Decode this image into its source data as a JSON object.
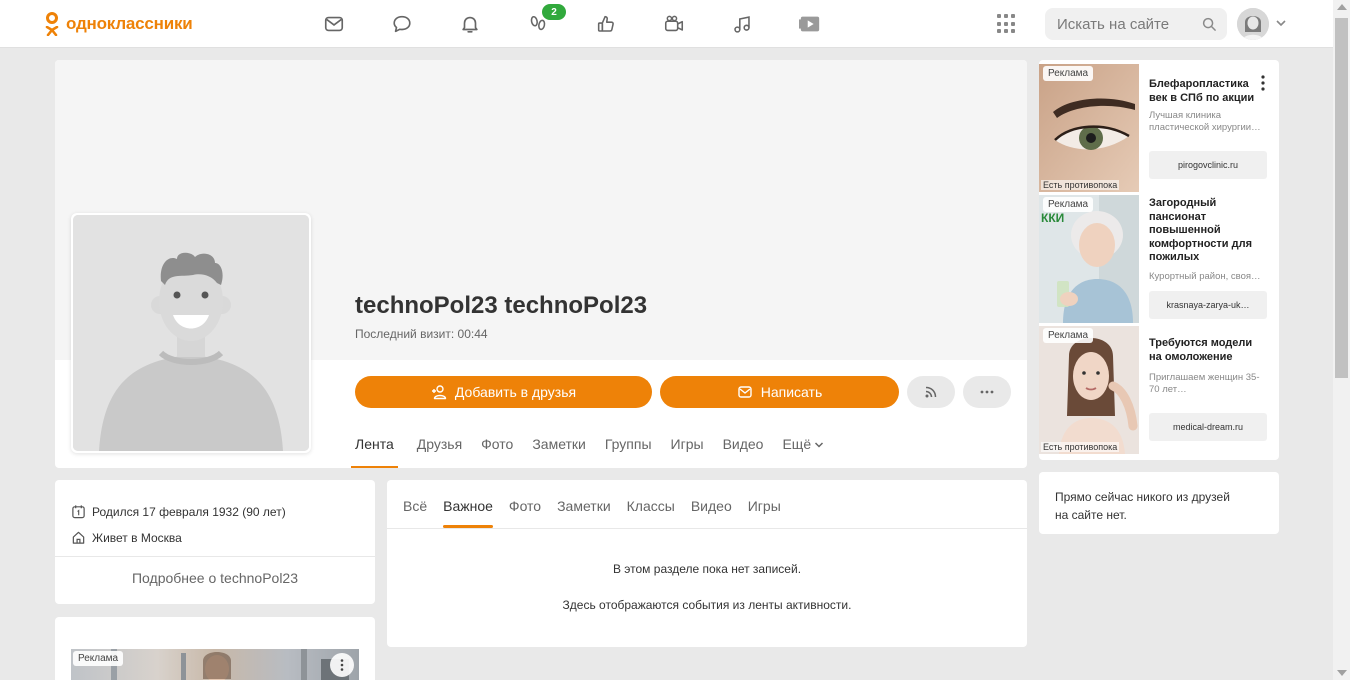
{
  "app": {
    "logo_text": "одноклассники",
    "accent_color": "#ee8208"
  },
  "topnav": {
    "items": [
      {
        "name": "messages",
        "icon": "envelope-icon"
      },
      {
        "name": "discussions",
        "icon": "chat-bubble-icon"
      },
      {
        "name": "notifications",
        "icon": "bell-icon"
      },
      {
        "name": "guests",
        "icon": "footprints-icon",
        "badge": "2"
      },
      {
        "name": "events",
        "icon": "thumbs-up-icon"
      },
      {
        "name": "video-calls",
        "icon": "camera-icon"
      },
      {
        "name": "music",
        "icon": "music-note-icon"
      },
      {
        "name": "video",
        "icon": "play-icon"
      }
    ],
    "badge_color": "#31a93c"
  },
  "search": {
    "placeholder": "Искать на сайте"
  },
  "profile": {
    "name": "technoPol23 technoPol23",
    "last_visit": "Последний визит: 00:44",
    "add_friend_label": "Добавить в друзья",
    "message_label": "Написать",
    "tabs": [
      "Лента",
      "Друзья",
      "Фото",
      "Заметки",
      "Группы",
      "Игры",
      "Видео",
      "Ещё"
    ],
    "active_tab": "Лента"
  },
  "info": {
    "birth": "Родился 17 февраля 1932 (90 лет)",
    "city": "Живет в Москва",
    "more": "Подробнее о technoPol23"
  },
  "feed": {
    "tabs": [
      "Всё",
      "Важное",
      "Фото",
      "Заметки",
      "Классы",
      "Видео",
      "Игры"
    ],
    "active_tab": "Важное",
    "empty_line1": "В этом разделе пока нет записей.",
    "empty_line2": "Здесь отображаются события из ленты активности."
  },
  "ad_label": "Реклама",
  "ads": [
    {
      "title": "Блефаропластика век в СПб по акции",
      "desc": "Лучшая клиника пластической хирургии…",
      "link": "pirogovclinic.ru",
      "caption": "Есть противопока"
    },
    {
      "title": "Загородный пансионат повышенной комфортности для пожилых",
      "desc": "Курортный район, своя…",
      "link": "krasnaya-zarya-uk…",
      "caption": "",
      "image_text": "ККИ"
    },
    {
      "title": "Требуются модели на омоложение",
      "desc": "Приглашаем женщин 35-70 лет…",
      "link": "medical-dream.ru",
      "caption": "Есть противопока"
    }
  ],
  "friends_online": {
    "text_line1": "Прямо сейчас никого из друзей",
    "text_line2": "на сайте нет."
  }
}
